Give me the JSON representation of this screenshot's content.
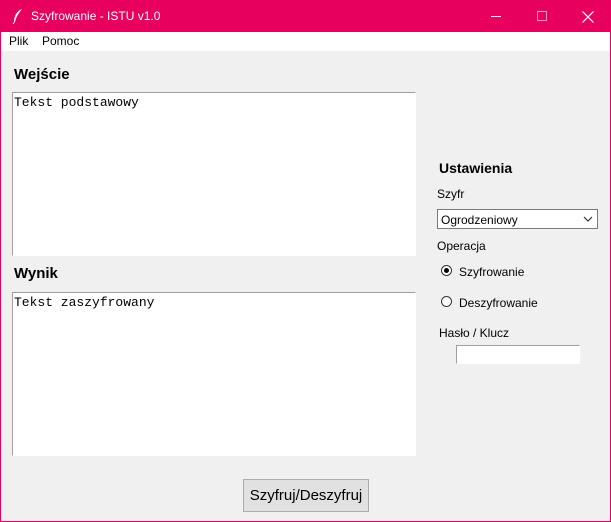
{
  "window": {
    "title": "Szyfrowanie - ISTU v1.0",
    "accent": "#e8005f",
    "controls": {
      "minimize": "minimize-icon",
      "maximize": "maximize-icon",
      "close": "close-icon"
    }
  },
  "menu": {
    "items": [
      "Plik",
      "Pomoc"
    ]
  },
  "input": {
    "heading": "Wejście",
    "text": "Tekst podstawowy"
  },
  "output": {
    "heading": "Wynik",
    "text": "Tekst zaszyfrowany"
  },
  "settings": {
    "heading": "Ustawienia",
    "cipher_label": "Szyfr",
    "cipher_value": "Ogrodzeniowy",
    "operation_label": "Operacja",
    "operations": [
      {
        "label": "Szyfrowanie",
        "selected": true
      },
      {
        "label": "Deszyfrowanie",
        "selected": false
      }
    ],
    "key_label": "Hasło / Klucz",
    "key_value": ""
  },
  "action": {
    "button_label": "Szyfruj/Deszyfruj"
  }
}
